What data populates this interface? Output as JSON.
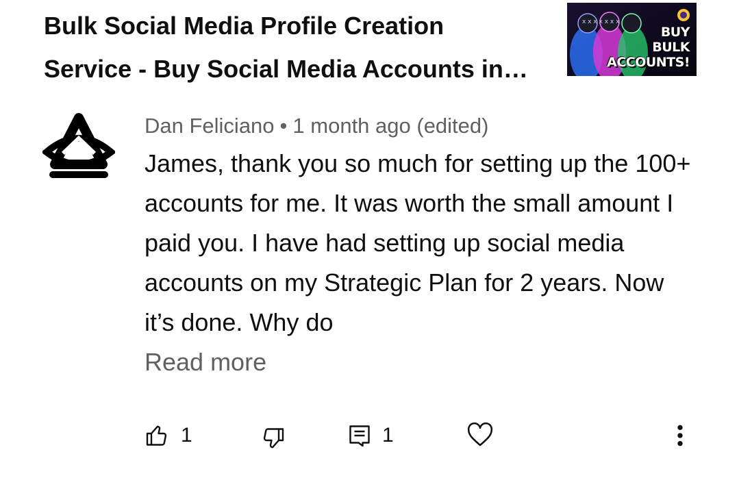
{
  "video": {
    "title": "Bulk Social Media Profile Creation Service - Buy Social Media Accounts in Bulk",
    "thumbnail_text": [
      "BUY",
      "BULK",
      "ACCOUNTS!"
    ]
  },
  "comment": {
    "author": "Dan Feliciano",
    "separator": "•",
    "time": "1 month ago (edited)",
    "text": "James, thank you so much for setting up the 100+ accounts for me. It was worth the small amount I paid you. I have had setting up social media accounts on my Strategic Plan for 2 years. Now it’s done. Why do",
    "read_more": "Read more"
  },
  "actions": {
    "like_count": "1",
    "reply_count": "1",
    "icons": [
      "thumbs-up-icon",
      "thumbs-down-icon",
      "reply-icon",
      "heart-icon",
      "more-vert-icon"
    ]
  },
  "colors": {
    "text_primary": "#0f0f0f",
    "text_secondary": "#606060",
    "background": "#ffffff"
  }
}
